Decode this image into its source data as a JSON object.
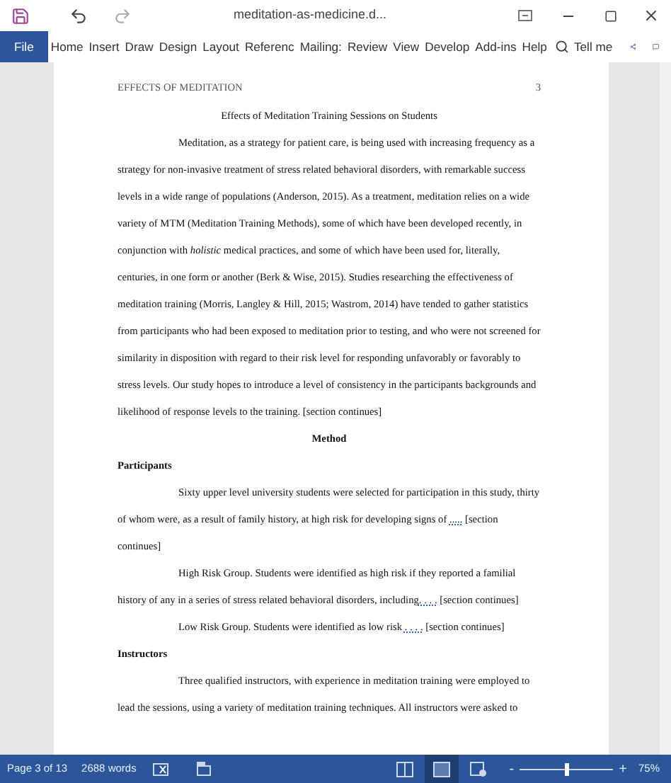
{
  "window": {
    "title": "meditation-as-medicine.d..."
  },
  "ribbon": {
    "tabs": [
      {
        "label": "File",
        "selected": true
      },
      {
        "label": "Home",
        "selected": false
      },
      {
        "label": "Insert",
        "selected": false
      },
      {
        "label": "Draw",
        "selected": false
      },
      {
        "label": "Design",
        "selected": false
      },
      {
        "label": "Layout",
        "selected": false
      },
      {
        "label": "Referenc",
        "selected": false
      },
      {
        "label": "Mailing:",
        "selected": false
      },
      {
        "label": "Review",
        "selected": false
      },
      {
        "label": "View",
        "selected": false
      },
      {
        "label": "Develop",
        "selected": false
      },
      {
        "label": "Add-ins",
        "selected": false
      },
      {
        "label": "Help",
        "selected": false
      }
    ],
    "tell_me": "Tell me"
  },
  "document": {
    "header": "EFFECTS OF MEDITATION",
    "page_number": "3",
    "title": "Effects of Meditation Training Sessions on Students",
    "blocks": [
      {
        "kind": "para",
        "segments": [
          {
            "text": "Meditation, as a strategy for patient care, is being used with increasing frequency as a strategy for non-invasive treatment of stress related behavioral disorders, with remarkable success levels in a wide range of populations (Anderson, 2015). As a treatment, meditation relies on a wide variety of MTM (Meditation Training Methods), some of which have been developed recently, in conjunction with *holistic* medical practices, and some of which have been used for, literally, centuries, in one form or another (Berk & Wise, 2015). Studies researching the effectiveness of meditation training (Morris, Langley & Hill, 2015; Wastrom, 2014) have tended to gather statistics from participants who had been exposed to meditation prior to testing, and who were not screened for similarity in disposition with regard to their risk level for responding unfavorably or favorably to stress levels. Our study hopes to introduce a level of consistency in the participants backgrounds and likelihood of response levels to the training. [section continues]",
            "flagged": false
          }
        ]
      },
      {
        "kind": "heading1",
        "text": "Method"
      },
      {
        "kind": "heading2",
        "text": "Participants"
      },
      {
        "kind": "para",
        "segments": [
          {
            "text": "Sixty upper level university students were selected for participation in this study, thirty of whom were, as a result of family history, at high risk for developing signs of ",
            "flagged": false
          },
          {
            "text": ".....",
            "flagged": true
          },
          {
            "text": " [section continues]",
            "flagged": false
          }
        ]
      },
      {
        "kind": "para",
        "segments": [
          {
            "text": "High Risk Group. Students were identified as high risk if they reported a familial history of any in a series of stress related behavioral disorders, including",
            "flagged": false
          },
          {
            "text": ". . . .",
            "flagged": true
          },
          {
            "text": " [section continues]",
            "flagged": false
          }
        ]
      },
      {
        "kind": "para",
        "segments": [
          {
            "text": "Low Risk Group. Students were identified as low risk ",
            "flagged": false
          },
          {
            "text": ". . . .",
            "flagged": true
          },
          {
            "text": " [section continues]",
            "flagged": false
          }
        ]
      },
      {
        "kind": "heading2",
        "text": "Instructors"
      },
      {
        "kind": "para",
        "segments": [
          {
            "text": "Three qualified instructors, with experience in meditation training were employed to lead the sessions, using a variety of meditation training techniques. All instructors were asked to",
            "flagged": false
          }
        ]
      }
    ]
  },
  "status_bar": {
    "page": "Page 3 of 13",
    "words": "2688 words",
    "views": [
      {
        "kind": "read",
        "selected": false
      },
      {
        "kind": "print",
        "selected": true
      },
      {
        "kind": "web",
        "selected": false
      }
    ],
    "zoom": {
      "level": 0.5,
      "minus": "-",
      "plus": "+",
      "reading": "75%"
    }
  }
}
